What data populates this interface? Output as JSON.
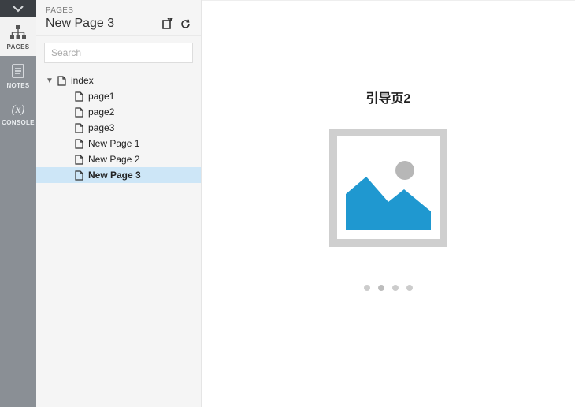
{
  "rail": {
    "items": [
      {
        "key": "pages",
        "label": "PAGES",
        "active": true
      },
      {
        "key": "notes",
        "label": "NOTES",
        "active": false
      },
      {
        "key": "console",
        "label": "CONSOLE",
        "active": false
      }
    ]
  },
  "panel": {
    "overline": "PAGES",
    "title": "New Page 3",
    "search_placeholder": "Search"
  },
  "tree": {
    "root": {
      "name": "index",
      "expanded": true
    },
    "children": [
      {
        "name": "page1",
        "selected": false
      },
      {
        "name": "page2",
        "selected": false
      },
      {
        "name": "page3",
        "selected": false
      },
      {
        "name": "New Page 1",
        "selected": false
      },
      {
        "name": "New Page 2",
        "selected": false
      },
      {
        "name": "New Page 3",
        "selected": true
      }
    ]
  },
  "preview": {
    "title": "引导页2",
    "dots": {
      "count": 4,
      "active_index": 1
    }
  }
}
